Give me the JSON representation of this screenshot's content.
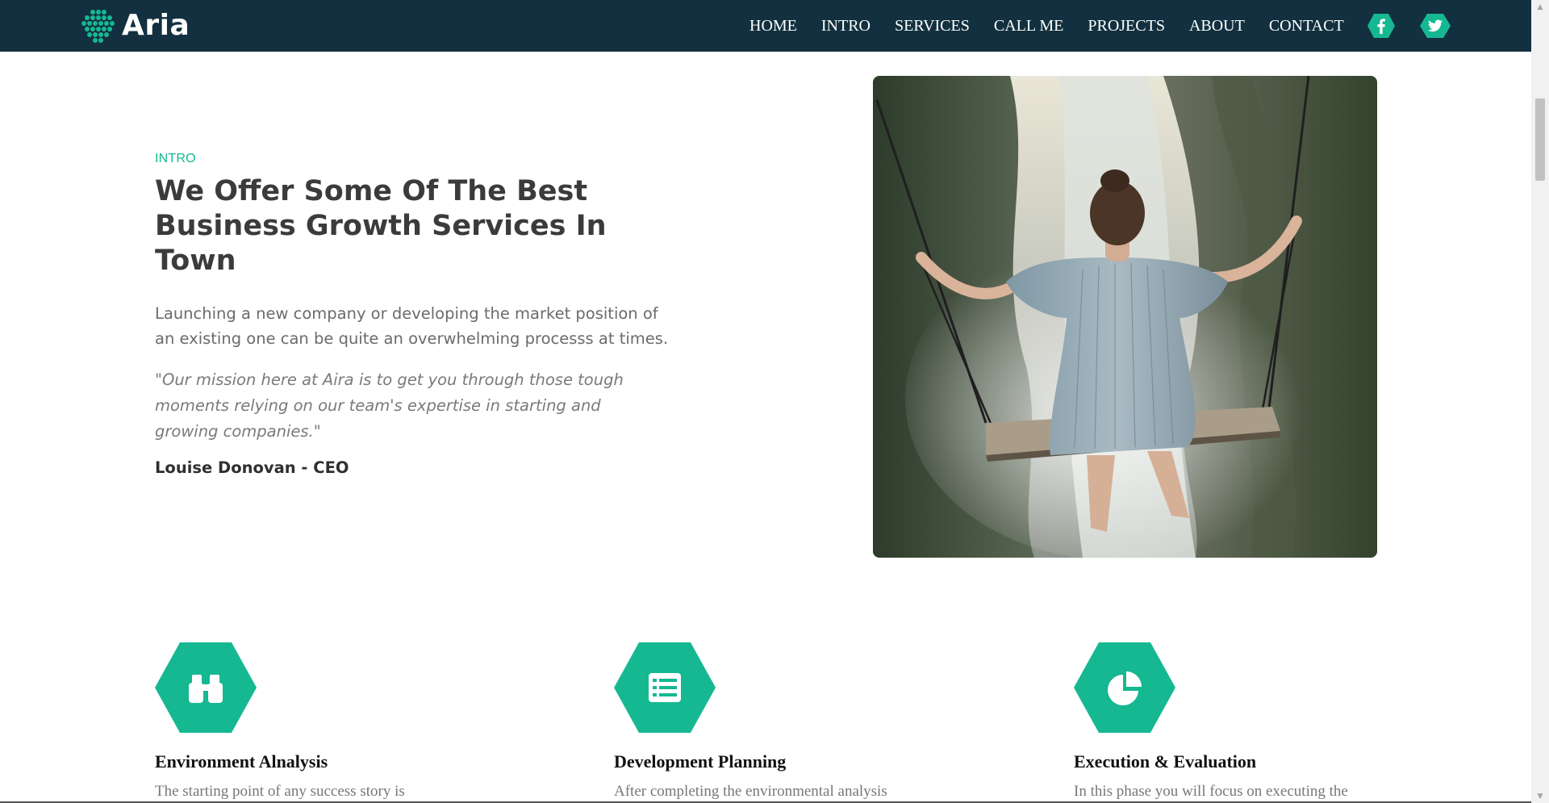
{
  "brand": {
    "name": "Aria"
  },
  "nav": {
    "links": [
      {
        "label": "HOME"
      },
      {
        "label": "INTRO"
      },
      {
        "label": "SERVICES"
      },
      {
        "label": "CALL ME"
      },
      {
        "label": "PROJECTS"
      },
      {
        "label": "ABOUT"
      },
      {
        "label": "CONTACT"
      }
    ],
    "social": [
      {
        "icon": "facebook-icon"
      },
      {
        "icon": "twitter-icon"
      }
    ]
  },
  "intro": {
    "kicker": "INTRO",
    "headline": "We Offer Some Of The Best Business Growth Services In Town",
    "lead": "Launching a new company or developing the market position of an existing one can be quite an overwhelming processs at times.",
    "quote": "\"Our mission here at Aira is to get you through those tough moments relying on our team's expertise in starting and growing companies.\"",
    "author": "Louise Donovan - CEO"
  },
  "services": [
    {
      "icon": "binoculars-icon",
      "title": "Environment Alnalysis",
      "text": "The starting point of any success story is"
    },
    {
      "icon": "list-icon",
      "title": "Development Planning",
      "text": "After completing the environmental analysis"
    },
    {
      "icon": "pie-chart-icon",
      "title": "Execution & Evaluation",
      "text": "In this phase you will focus on executing the"
    }
  ],
  "colors": {
    "navbar": "#12303f",
    "accent": "#16b892",
    "heading": "#3b3b3b",
    "body_text": "#6b6b6b"
  }
}
